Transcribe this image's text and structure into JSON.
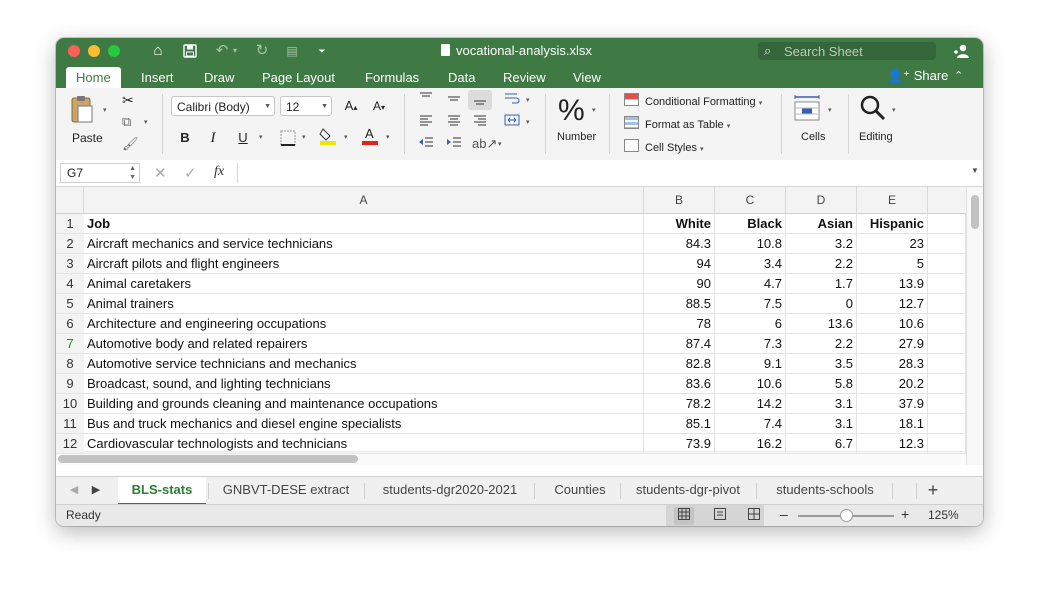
{
  "window": {
    "file_name": "vocational-analysis.xlsx",
    "search_placeholder": "Search Sheet"
  },
  "ribbon_tabs": [
    "Home",
    "Insert",
    "Draw",
    "Page Layout",
    "Formulas",
    "Data",
    "Review",
    "View"
  ],
  "share_label": "Share",
  "ribbon": {
    "paste": "Paste",
    "font_name": "Calibri (Body)",
    "font_size": "12",
    "bold": "B",
    "italic": "I",
    "underline": "U",
    "number_symbol": "%",
    "number": "Number",
    "conditional_formatting": "Conditional Formatting",
    "format_as_table": "Format as Table",
    "cell_styles": "Cell Styles",
    "cells": "Cells",
    "editing": "Editing"
  },
  "formula_bar": {
    "name_box": "G7",
    "fx": "fx",
    "formula": ""
  },
  "columns": [
    "A",
    "B",
    "C",
    "D",
    "E"
  ],
  "rows": [
    {
      "n": "1",
      "cells": [
        "Job",
        "White",
        "Black",
        "Asian",
        "Hispanic"
      ]
    },
    {
      "n": "2",
      "cells": [
        "Aircraft mechanics and service technicians",
        "84.3",
        "10.8",
        "3.2",
        "23"
      ]
    },
    {
      "n": "3",
      "cells": [
        "Aircraft pilots and flight engineers",
        "94",
        "3.4",
        "2.2",
        "5"
      ]
    },
    {
      "n": "4",
      "cells": [
        "Animal caretakers",
        "90",
        "4.7",
        "1.7",
        "13.9"
      ]
    },
    {
      "n": "5",
      "cells": [
        "Animal trainers",
        "88.5",
        "7.5",
        "0",
        "12.7"
      ]
    },
    {
      "n": "6",
      "cells": [
        "Architecture and engineering occupations",
        "78",
        "6",
        "13.6",
        "10.6"
      ]
    },
    {
      "n": "7",
      "cells": [
        "Automotive body and related repairers",
        "87.4",
        "7.3",
        "2.2",
        "27.9"
      ]
    },
    {
      "n": "8",
      "cells": [
        "Automotive service technicians and mechanics",
        "82.8",
        "9.1",
        "3.5",
        "28.3"
      ]
    },
    {
      "n": "9",
      "cells": [
        "Broadcast, sound, and lighting technicians",
        "83.6",
        "10.6",
        "5.8",
        "20.2"
      ]
    },
    {
      "n": "10",
      "cells": [
        "Building and grounds cleaning and maintenance occupations",
        "78.2",
        "14.2",
        "3.1",
        "37.9"
      ]
    },
    {
      "n": "11",
      "cells": [
        "Bus and truck mechanics and diesel engine specialists",
        "85.1",
        "7.4",
        "3.1",
        "18.1"
      ]
    },
    {
      "n": "12",
      "cells": [
        "Cardiovascular technologists and technicians",
        "73.9",
        "16.2",
        "6.7",
        "12.3"
      ]
    }
  ],
  "sheet_tabs": [
    "BLS-stats",
    "GNBVT-DESE extract",
    "students-dgr2020-2021",
    "Counties",
    "students-dgr-pivot",
    "students-schools"
  ],
  "active_sheet": "BLS-stats",
  "status": {
    "text": "Ready",
    "zoom": "125%",
    "zoom_fraction": 0.5,
    "minus": "–",
    "plus": "+"
  }
}
